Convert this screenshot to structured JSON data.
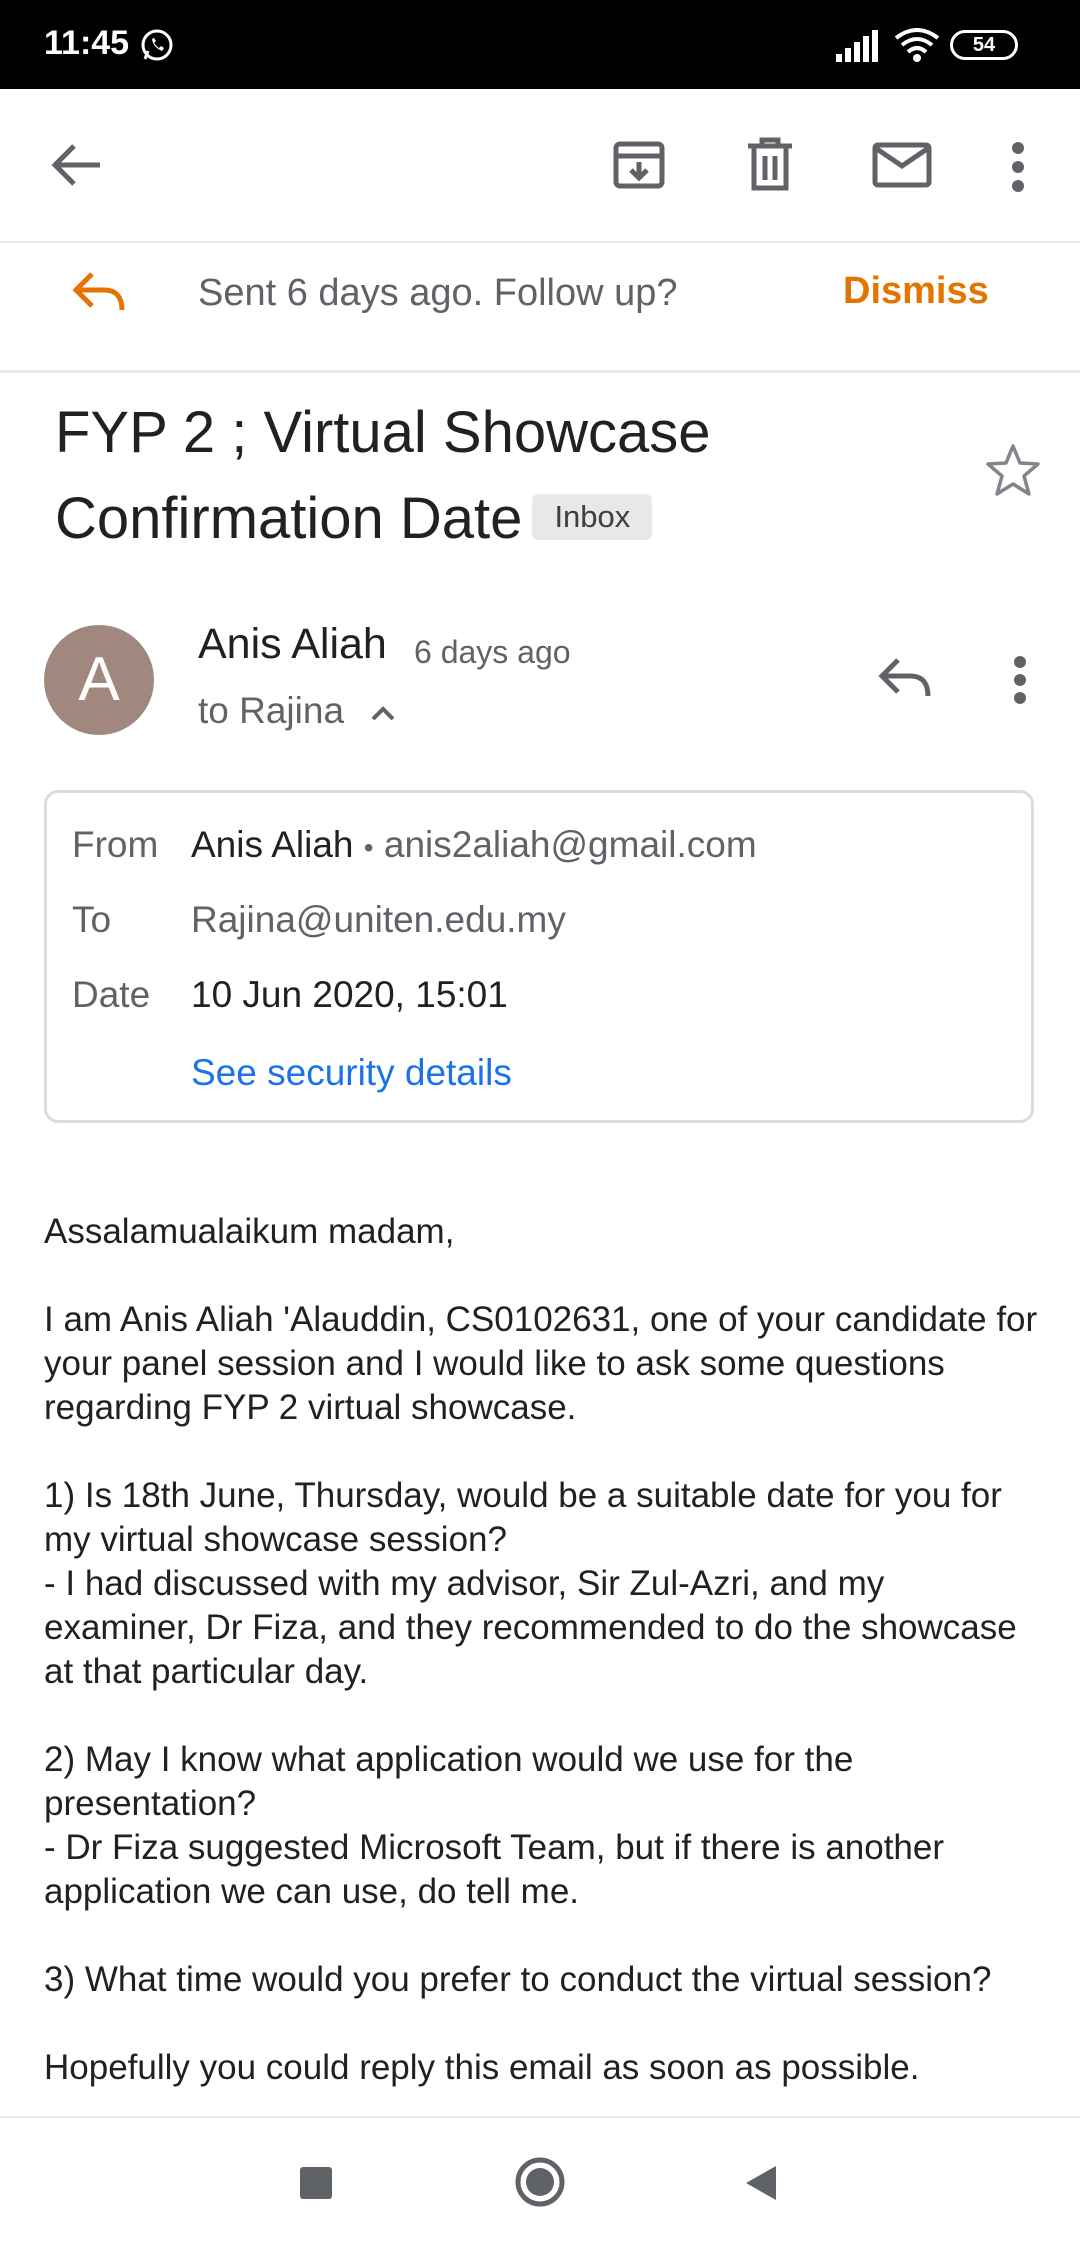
{
  "status_bar": {
    "time": "11:45",
    "battery": "54"
  },
  "toolbar": {
    "back_icon": "arrow-back-icon",
    "archive_icon": "archive-icon",
    "delete_icon": "trash-icon",
    "mark_unread_icon": "mail-icon",
    "more_icon": "more-vert-icon"
  },
  "followup": {
    "text": "Sent 6 days ago. Follow up?",
    "dismiss_label": "Dismiss"
  },
  "email": {
    "subject_line1": "FYP 2 ; Virtual Showcase",
    "subject_line2": "Confirmation Date",
    "label": "Inbox",
    "sender_initial": "A",
    "sender_name": "Anis Aliah",
    "time_ago": "6 days ago",
    "to_line": "to Rajina",
    "details": {
      "from_label": "From",
      "from_name": "Anis Aliah",
      "separator": "•",
      "from_email": "anis2aliah@gmail.com",
      "to_label": "To",
      "to_value": "Rajina@uniten.edu.my",
      "date_label": "Date",
      "date_value": "10 Jun 2020, 15:01",
      "security_link": "See security details"
    },
    "body": {
      "greeting": "Assalamualaikum madam,",
      "intro": "I am Anis Aliah 'Alauddin, CS0102631, one of your candidate for your panel session and I would like to ask some questions regarding FYP 2 virtual showcase.",
      "q1": "1) Is 18th June, Thursday, would be a suitable date for you for my virtual showcase session?",
      "q1_note": "- I had discussed with my advisor, Sir Zul-Azri, and my examiner, Dr Fiza, and they recommended to do the showcase at that particular day.",
      "q2": "2) May I know what application would we use for the presentation?",
      "q2_note": "- Dr Fiza suggested Microsoft Team, but if there is another application we can use, do tell me.",
      "q3": "3) What time would you prefer to conduct the virtual session?",
      "closing": "Hopefully you could reply this email as soon as possible."
    }
  },
  "colors": {
    "accent_orange": "#e37400",
    "link_blue": "#1a73e8",
    "avatar_bg": "#a1887f"
  }
}
